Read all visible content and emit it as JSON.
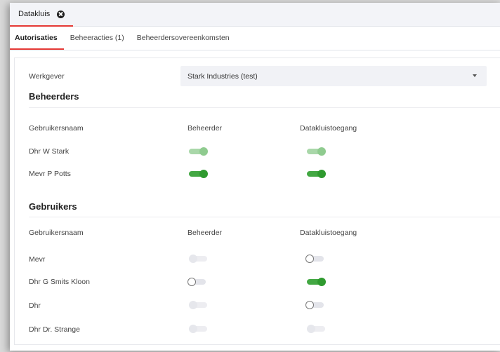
{
  "document_tab": {
    "label": "Datakluis",
    "close_icon": "close-icon"
  },
  "subtabs": [
    {
      "label": "Autorisaties",
      "active": true
    },
    {
      "label": "Beheeracties (1)",
      "active": false
    },
    {
      "label": "Beheerdersovereenkomsten",
      "active": false
    }
  ],
  "employer": {
    "label": "Werkgever",
    "value": "Stark Industries (test)",
    "icon": "chevron-down-icon"
  },
  "administrators": {
    "title": "Beheerders",
    "columns": [
      "Gebruikersnaam",
      "Beheerder",
      "Datakluistoegang"
    ],
    "rows": [
      {
        "name": "Dhr W Stark",
        "beheerder": "on-disabled",
        "datakluis": "on-disabled"
      },
      {
        "name": "Mevr P Potts",
        "beheerder": "on",
        "datakluis": "on"
      }
    ]
  },
  "users": {
    "title": "Gebruikers",
    "columns": [
      "Gebruikersnaam",
      "Beheerder",
      "Datakluistoegang"
    ],
    "rows": [
      {
        "name": "Mevr",
        "beheerder": "off-disabled",
        "datakluis": "off"
      },
      {
        "name": "Dhr G Smits Kloon",
        "beheerder": "off",
        "datakluis": "on"
      },
      {
        "name": "Dhr",
        "beheerder": "off-disabled",
        "datakluis": "off"
      },
      {
        "name": "Dhr Dr. Strange",
        "beheerder": "off-disabled",
        "datakluis": "off-disabled"
      }
    ]
  },
  "colors": {
    "accent": "#e53935",
    "toggle_on": "#2f9a2f",
    "toggle_on_disabled": "#8fcb8f"
  }
}
